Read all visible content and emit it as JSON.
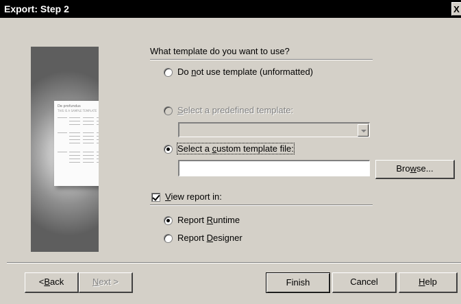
{
  "window": {
    "title": "Export: Step 2",
    "close_glyph": "X"
  },
  "illustration": {
    "doc_title": "De profundus",
    "doc_subtitle": "THIS IS A SAMPLE TEMPLATE"
  },
  "question": "What template do you want to use?",
  "template_options": [
    {
      "label_pre": "Do ",
      "accel": "n",
      "label_post": "ot use template (unformatted)",
      "checked": false,
      "enabled": true
    },
    {
      "label_pre": "",
      "accel": "S",
      "label_post": "elect a predefined template:",
      "checked": false,
      "enabled": false
    },
    {
      "label_pre": "Select a ",
      "accel": "c",
      "label_post": "ustom template file:",
      "checked": true,
      "enabled": true
    }
  ],
  "predefined_template_value": "",
  "custom_template_value": "",
  "browse_button": {
    "pre": "Bro",
    "accel": "w",
    "post": "se..."
  },
  "view_report": {
    "pre": "",
    "accel": "V",
    "post": "iew report in:",
    "checked": true
  },
  "view_options": [
    {
      "pre": "Report ",
      "accel": "R",
      "post": "untime",
      "checked": true
    },
    {
      "pre": "Report ",
      "accel": "D",
      "post": "esigner",
      "checked": false
    }
  ],
  "footer": {
    "back": {
      "pre": "< ",
      "accel": "B",
      "post": "ack"
    },
    "next": {
      "pre": "",
      "accel": "N",
      "post": "ext >"
    },
    "finish": "Finish",
    "cancel": "Cancel",
    "help": {
      "pre": "",
      "accel": "H",
      "post": "elp"
    }
  }
}
